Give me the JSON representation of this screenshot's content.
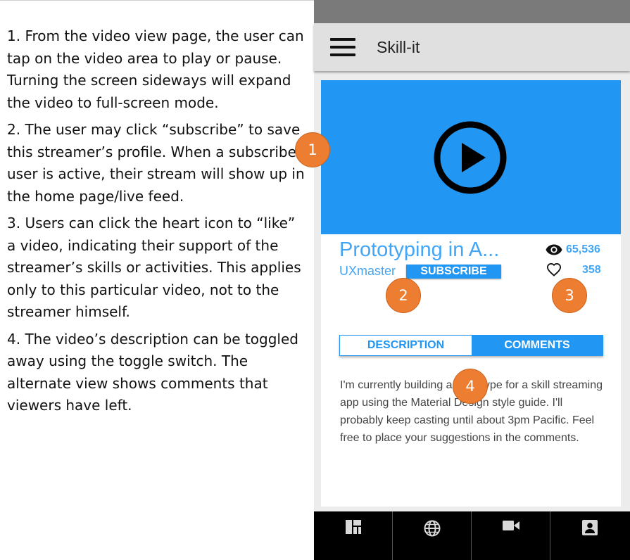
{
  "notes": [
    "1. From the video view page, the user can tap on the video area to play or pause. Turning the screen sideways will expand the video to full-screen mode.",
    "2. The user may click “subscribe” to save this streamer’s profile. When a subscribed user is active, their stream will show up in the home page/live feed.",
    "3. Users can click the heart icon to “like” a video, indicating their support of the streamer’s skills or activities. This applies only to this particular video, not to the streamer himself.",
    "4. The video’s description can be toggled away using the toggle switch. The alternate view shows comments that viewers have left."
  ],
  "app": {
    "title": "Skill-it",
    "menu_icon": "hamburger-menu-icon"
  },
  "video": {
    "play_icon": "play-circle-icon",
    "title": "Prototyping in A...",
    "channel": "UXmaster",
    "subscribe_label": "SUBSCRIBE",
    "views": "65,536",
    "likes": "358"
  },
  "tabs": {
    "description_label": "DESCRIPTION",
    "comments_label": "COMMENTS",
    "active": "COMMENTS"
  },
  "description": "I'm currently building a prototype for a skill streaming app using the Material Design style guide. I'll probably keep casting until about 3pm Pacific. Feel free to place your suggestions in the comments.",
  "badges": [
    "1",
    "2",
    "3",
    "4"
  ],
  "bottom_nav": [
    {
      "icon": "dashboard-icon"
    },
    {
      "icon": "globe-icon"
    },
    {
      "icon": "videocam-icon"
    },
    {
      "icon": "profile-icon"
    }
  ],
  "colors": {
    "accent": "#2196f3",
    "badge": "#ed7d31",
    "status_bar": "#7a7a7a",
    "app_bar": "#e0e0e0"
  }
}
